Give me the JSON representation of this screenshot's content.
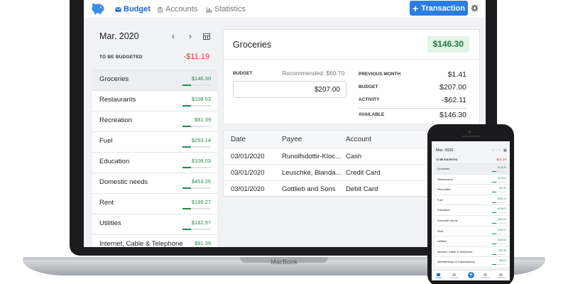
{
  "nav": {
    "budget": "Budget",
    "accounts": "Accounts",
    "statistics": "Statistics",
    "add_transaction": "Transaction"
  },
  "sidebar": {
    "month": "Mar. 2020",
    "to_be_budgeted_label": "TO BE BUDGETED",
    "to_be_budgeted_value": "-$11.19",
    "categories": [
      {
        "name": "Groceries",
        "amount": "$146.30"
      },
      {
        "name": "Restaurants",
        "amount": "$108.03"
      },
      {
        "name": "Recreation",
        "amount": "$91.39"
      },
      {
        "name": "Fuel",
        "amount": "$253.14"
      },
      {
        "name": "Education",
        "amount": "$108.03"
      },
      {
        "name": "Domestic needs",
        "amount": "$453.25"
      },
      {
        "name": "Rent",
        "amount": "$199.27"
      },
      {
        "name": "Utilities",
        "amount": "$182.57"
      },
      {
        "name": "Internet, Cable & Telephone",
        "amount": "$91.39"
      }
    ]
  },
  "detail": {
    "title": "Groceries",
    "available_badge": "$146.30",
    "budget_label": "BUDGET",
    "recommended": "Recommended: $60.70",
    "budget_input": "$207.00",
    "stats": [
      {
        "label": "PREVIOUS MONTH",
        "value": "$1.41"
      },
      {
        "label": "BUDGET",
        "value": "$207.00"
      },
      {
        "label": "ACTIVITY",
        "value": "-$62.11"
      },
      {
        "label": "AVAILABLE",
        "value": "$146.30"
      }
    ]
  },
  "transactions": {
    "columns": [
      "Date",
      "Payee",
      "Account"
    ],
    "rows": [
      {
        "date": "03/01/2020",
        "payee": "Runolfsdottir-Kloc...",
        "account": "Cash"
      },
      {
        "date": "03/01/2020",
        "payee": "Leuschke, Blanda...",
        "account": "Credit Card"
      },
      {
        "date": "03/01/2020",
        "payee": "Gottlieb and Sons",
        "account": "Debit Card"
      }
    ]
  },
  "laptop": {
    "brand": "MacBook"
  },
  "phone": {
    "month": "Mar. 2020",
    "to_be_budgeted_label": "TO BE BUDGETED",
    "to_be_budgeted_value": "-$11.19",
    "categories": [
      {
        "name": "Groceries",
        "amount": "$146.30"
      },
      {
        "name": "Restaurants",
        "amount": "$108.03"
      },
      {
        "name": "Recreation",
        "amount": "$91.39"
      },
      {
        "name": "Fuel",
        "amount": "$253.14"
      },
      {
        "name": "Education",
        "amount": "$108.03"
      },
      {
        "name": "Domestic needs",
        "amount": "$453.25"
      },
      {
        "name": "Rent",
        "amount": "$199.27"
      },
      {
        "name": "Utilities",
        "amount": "$182.57"
      },
      {
        "name": "Internet, Cable & Telephone",
        "amount": "$91.39"
      },
      {
        "name": "Memberships & Subscriptions",
        "amount": "$45.00"
      }
    ],
    "tabs": [
      "Budget",
      "Accounts",
      "Statistics",
      "Settings"
    ]
  },
  "colors": {
    "accent": "#2a7de1",
    "positive": "#27884b",
    "negative": "#d9363e",
    "available_badge_bg": "#e2f4e6"
  }
}
